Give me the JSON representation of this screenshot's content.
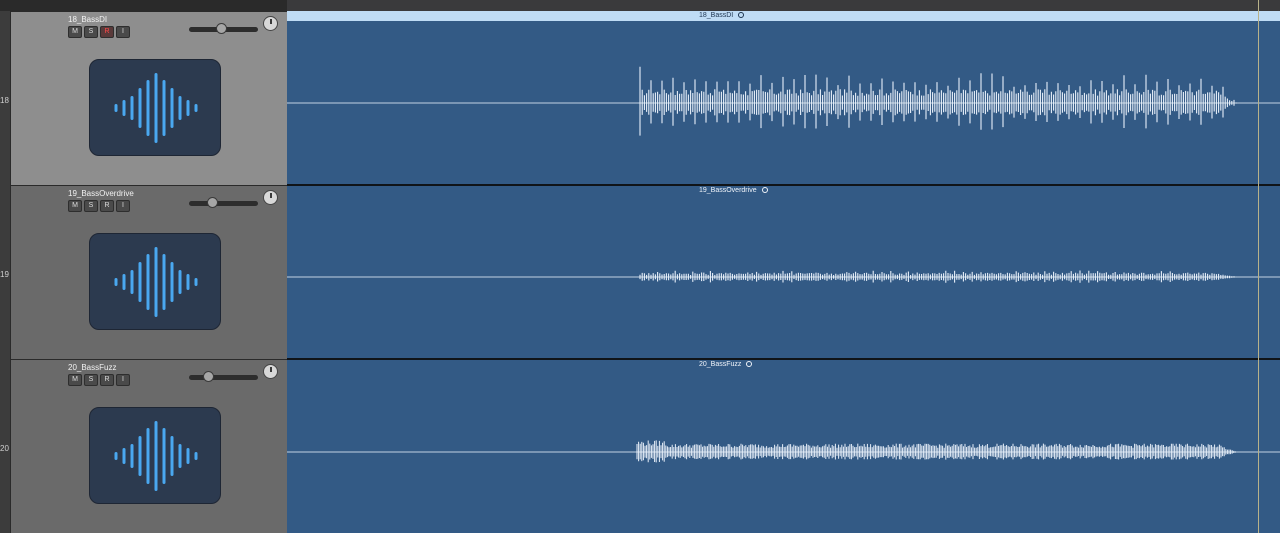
{
  "tracks": [
    {
      "number": "18",
      "name": "18_BassDI",
      "selected": true,
      "buttons": {
        "mute": "M",
        "solo": "S",
        "record": "R",
        "input": "I"
      },
      "record_armed": true,
      "volume": 0.46,
      "region": {
        "name": "18_BassDI"
      },
      "amplitude": 0.9
    },
    {
      "number": "19",
      "name": "19_BassOverdrive",
      "selected": false,
      "buttons": {
        "mute": "M",
        "solo": "S",
        "record": "R",
        "input": "I"
      },
      "record_armed": false,
      "volume": 0.33,
      "region": {
        "name": "19_BassOverdrive"
      },
      "amplitude": 0.25
    },
    {
      "number": "20",
      "name": "20_BassFuzz",
      "selected": false,
      "buttons": {
        "mute": "M",
        "solo": "S",
        "record": "R",
        "input": "I"
      },
      "record_armed": false,
      "volume": 0.27,
      "region": {
        "name": "20_BassFuzz"
      },
      "amplitude": 0.35
    }
  ],
  "colors": {
    "region": "#335a85",
    "region_selected_header": "#bfdcf5",
    "waveform": "#e8f0fa",
    "tile_bars": "#4aa8f0",
    "record_armed": "#ff4a4a"
  },
  "icons": {
    "track_tile": "audio-waveform-icon",
    "pan_knob": "pan-knob-icon",
    "loop": "loop-circle-icon"
  }
}
